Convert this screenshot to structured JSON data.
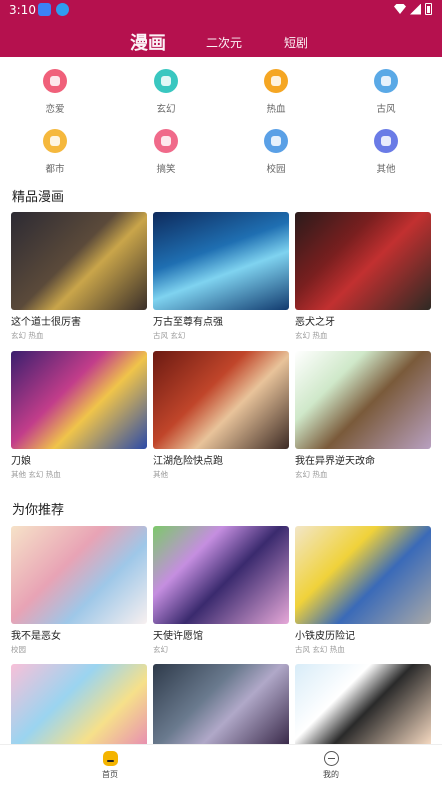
{
  "status_bar": {
    "time": "3:10"
  },
  "header": {
    "tabs": [
      {
        "label": "漫画",
        "active": true
      },
      {
        "label": "二次元",
        "active": false
      },
      {
        "label": "短剧",
        "active": false
      }
    ]
  },
  "categories": [
    {
      "label": "恋爱",
      "icon": "heart-icon",
      "color": "#f0607a"
    },
    {
      "label": "玄幻",
      "icon": "swirl-icon",
      "color": "#39c7c0"
    },
    {
      "label": "热血",
      "icon": "fire-icon",
      "color": "#f5a623"
    },
    {
      "label": "古风",
      "icon": "mountain-icon",
      "color": "#5aa9e6"
    },
    {
      "label": "都市",
      "icon": "building-icon",
      "color": "#f5b83d"
    },
    {
      "label": "搞笑",
      "icon": "smile-icon",
      "color": "#f06a8a"
    },
    {
      "label": "校园",
      "icon": "school-icon",
      "color": "#5aa0e6"
    },
    {
      "label": "其他",
      "icon": "grid-icon",
      "color": "#6a7be6"
    }
  ],
  "sections": [
    {
      "title": "精品漫画",
      "items": [
        {
          "title": "这个道士很厉害",
          "tags": "玄幻 热血"
        },
        {
          "title": "万古至尊有点强",
          "tags": "古风 玄幻"
        },
        {
          "title": "恶犬之牙",
          "tags": "玄幻 热血"
        },
        {
          "title": "刀娘",
          "tags": "其他 玄幻 热血"
        },
        {
          "title": "江湖危险快点跑",
          "tags": "其他"
        },
        {
          "title": "我在异界逆天改命",
          "tags": "玄幻 热血"
        }
      ]
    },
    {
      "title": "为你推荐",
      "items": [
        {
          "title": "我不是恶女",
          "tags": "校园"
        },
        {
          "title": "天使许愿馆",
          "tags": "玄幻"
        },
        {
          "title": "小铁皮历险记",
          "tags": "古风 玄幻 热血"
        },
        {
          "title": "",
          "tags": ""
        },
        {
          "title": "",
          "tags": ""
        },
        {
          "title": "",
          "tags": ""
        }
      ]
    }
  ],
  "bottom_nav": [
    {
      "label": "首页",
      "icon": "home-icon",
      "active": true
    },
    {
      "label": "我的",
      "icon": "profile-icon",
      "active": false
    }
  ],
  "colors": {
    "brand": "#b5114e",
    "home_icon": "#f4b400"
  }
}
